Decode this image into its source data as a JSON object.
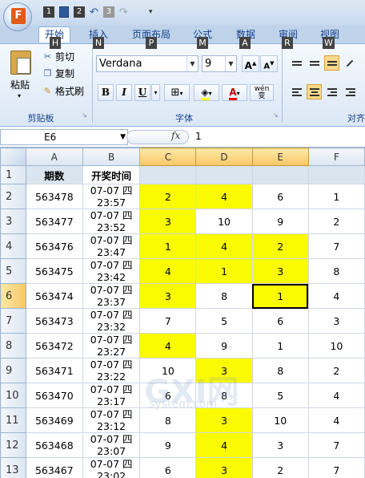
{
  "office_button": {
    "letter": "F",
    "key": "F"
  },
  "qat": {
    "keys": [
      "1",
      "2",
      "3"
    ]
  },
  "tabs": [
    {
      "label": "开始",
      "key": "H"
    },
    {
      "label": "插入",
      "key": "N"
    },
    {
      "label": "页面布局",
      "key": "P"
    },
    {
      "label": "公式",
      "key": "M"
    },
    {
      "label": "数据",
      "key": "A"
    },
    {
      "label": "审阅",
      "key": "R"
    },
    {
      "label": "视图",
      "key": "W"
    }
  ],
  "ribbon": {
    "clipboard": {
      "paste": "粘贴",
      "cut": "剪切",
      "copy": "复制",
      "format_painter": "格式刷",
      "group_label": "剪贴板"
    },
    "font": {
      "name": "Verdana",
      "size": "9",
      "bold": "B",
      "italic": "I",
      "underline": "U",
      "phonetic": "wén 变",
      "group_label": "字体"
    },
    "alignment": {
      "group_label": "对齐"
    }
  },
  "formula_bar": {
    "name_box": "E6",
    "fx": "fx",
    "value": "1"
  },
  "sheet": {
    "columns": [
      "A",
      "B",
      "C",
      "D",
      "E",
      "F"
    ],
    "header_row": {
      "row": "1",
      "a": "期数",
      "b": "开奖时间"
    },
    "rows": [
      {
        "row": "2",
        "a": "563478",
        "b1": "07-07 四",
        "b2": "23:57",
        "c": "2",
        "d": "4",
        "e": "6",
        "f": "1",
        "yellow": [
          "c",
          "d"
        ]
      },
      {
        "row": "3",
        "a": "563477",
        "b1": "07-07 四",
        "b2": "23:52",
        "c": "3",
        "d": "10",
        "e": "9",
        "f": "2",
        "yellow": [
          "c"
        ]
      },
      {
        "row": "4",
        "a": "563476",
        "b1": "07-07 四",
        "b2": "23:47",
        "c": "1",
        "d": "4",
        "e": "2",
        "f": "7",
        "yellow": [
          "c",
          "d",
          "e"
        ]
      },
      {
        "row": "5",
        "a": "563475",
        "b1": "07-07 四",
        "b2": "23:42",
        "c": "4",
        "d": "1",
        "e": "3",
        "f": "8",
        "yellow": [
          "c",
          "d",
          "e"
        ]
      },
      {
        "row": "6",
        "a": "563474",
        "b1": "07-07 四",
        "b2": "23:37",
        "c": "3",
        "d": "8",
        "e": "1",
        "f": "4",
        "yellow": [
          "c",
          "e"
        ]
      },
      {
        "row": "7",
        "a": "563473",
        "b1": "07-07 四",
        "b2": "23:32",
        "c": "7",
        "d": "5",
        "e": "6",
        "f": "3",
        "yellow": []
      },
      {
        "row": "8",
        "a": "563472",
        "b1": "07-07 四",
        "b2": "23:27",
        "c": "4",
        "d": "9",
        "e": "1",
        "f": "10",
        "yellow": [
          "c"
        ]
      },
      {
        "row": "9",
        "a": "563471",
        "b1": "07-07 四",
        "b2": "23:22",
        "c": "10",
        "d": "3",
        "e": "8",
        "f": "2",
        "yellow": [
          "d"
        ]
      },
      {
        "row": "10",
        "a": "563470",
        "b1": "07-07 四",
        "b2": "23:17",
        "c": "6",
        "d": "8",
        "e": "5",
        "f": "4",
        "yellow": []
      },
      {
        "row": "11",
        "a": "563469",
        "b1": "07-07 四",
        "b2": "23:12",
        "c": "8",
        "d": "3",
        "e": "10",
        "f": "4",
        "yellow": [
          "d"
        ]
      },
      {
        "row": "12",
        "a": "563468",
        "b1": "07-07 四",
        "b2": "23:07",
        "c": "9",
        "d": "4",
        "e": "3",
        "f": "7",
        "yellow": [
          "d"
        ]
      },
      {
        "row": "13",
        "a": "563467",
        "b1": "07-07 四",
        "b2": "23:02",
        "c": "6",
        "d": "3",
        "e": "2",
        "f": "7",
        "yellow": [
          "d"
        ]
      }
    ]
  },
  "watermark": {
    "text": "GXI网",
    "sub": "system.com"
  },
  "colors": {
    "highlight": "#fafa00",
    "selection": "#f8c766",
    "ribbon": "#dbe7f5"
  }
}
